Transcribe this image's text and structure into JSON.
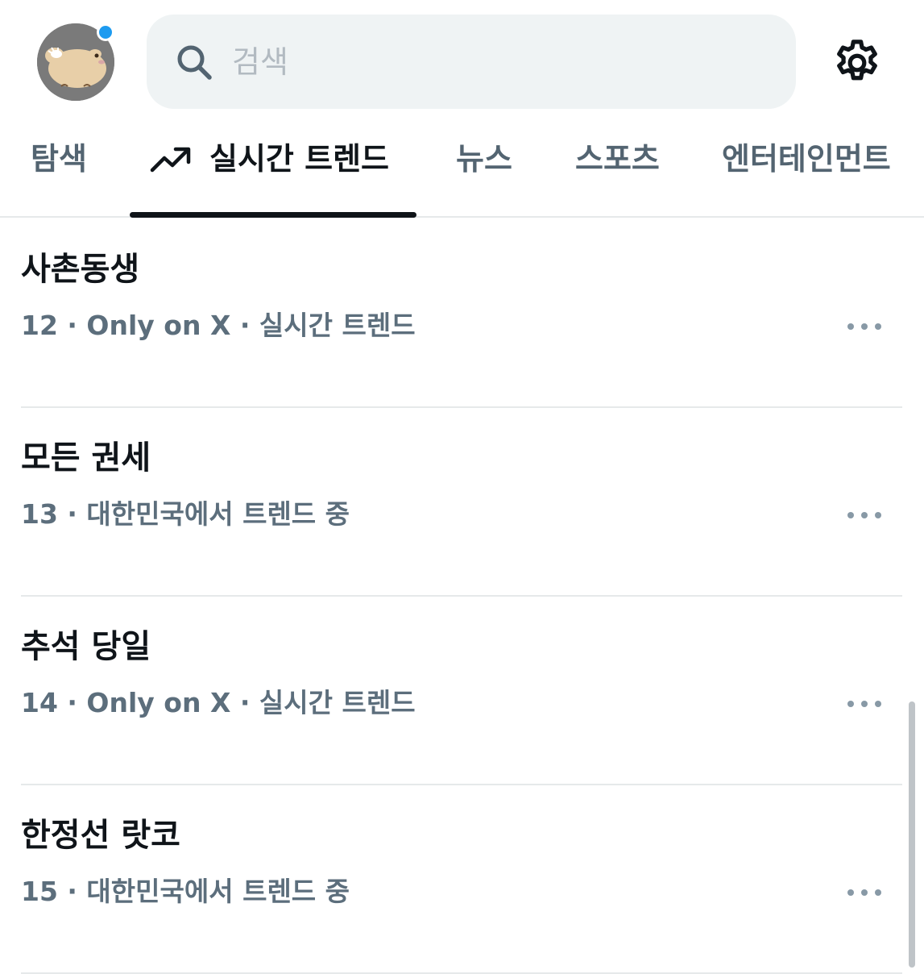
{
  "header": {
    "avatar_icon": "profile-avatar",
    "notification_dot_color": "#1d9bf0",
    "search": {
      "placeholder": "검색",
      "value": "",
      "icon": "search-icon"
    },
    "settings_icon": "gear-icon"
  },
  "tabs": [
    {
      "label": "탐색",
      "active": false
    },
    {
      "label": "실시간 트렌드",
      "active": true,
      "icon": "trending-arrow-icon"
    },
    {
      "label": "뉴스",
      "active": false
    },
    {
      "label": "스포츠",
      "active": false
    },
    {
      "label": "엔터테인먼트",
      "active": false
    }
  ],
  "trends": [
    {
      "title": "사촌동생",
      "meta": "12 · Only on X · 실시간 트렌드"
    },
    {
      "title": "모든 권세",
      "meta": "13 · 대한민국에서 트렌드 중"
    },
    {
      "title": "추석 당일",
      "meta": "14 · Only on X · 실시간 트렌드"
    },
    {
      "title": "한정선 랏코",
      "meta": "15 · 대한민국에서 트렌드 중"
    }
  ],
  "colors": {
    "accent": "#1d9bf0",
    "text_primary": "#0f1419",
    "text_secondary": "#536471",
    "search_bg": "#eff3f4",
    "divider": "#e6e9ea"
  }
}
